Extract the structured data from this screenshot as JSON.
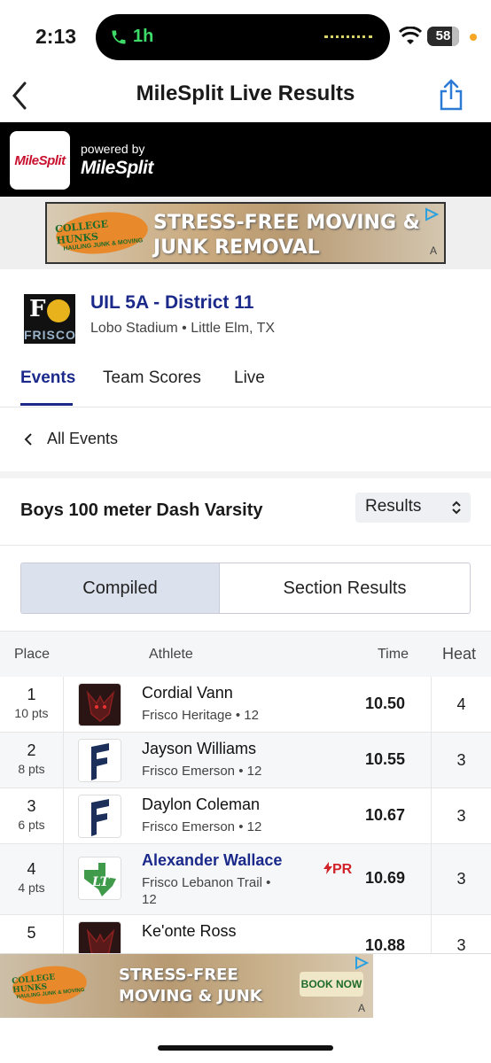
{
  "status_bar": {
    "time": "2:13",
    "call_duration": "1h",
    "battery": "58"
  },
  "nav": {
    "title": "MileSplit Live Results"
  },
  "brand_bar": {
    "logo_text": "MileSplit",
    "powered_by": "powered by",
    "brand_name": "MileSplit"
  },
  "ad_top": {
    "brand_line1": "COLLEGE HUNKS",
    "brand_line2": "HAULING JUNK & MOVING",
    "headline": "STRESS-FREE MOVING & JUNK REMOVAL",
    "badge": "A"
  },
  "meet": {
    "logo_text": "FRISCO",
    "title": "UIL 5A - District 11",
    "location": "Lobo Stadium • Little Elm, TX"
  },
  "tabs": [
    {
      "label": "Events",
      "active": true
    },
    {
      "label": "Team Scores",
      "active": false
    },
    {
      "label": "Live",
      "active": false
    }
  ],
  "all_events": "All Events",
  "event": {
    "title": "Boys 100 meter Dash Varsity",
    "view_select": "Results"
  },
  "segments": {
    "compiled": "Compiled",
    "sections": "Section Results"
  },
  "table": {
    "headers": {
      "place": "Place",
      "athlete": "Athlete",
      "time": "Time",
      "heat": "Heat"
    },
    "rows": [
      {
        "place": "1",
        "pts": "10 pts",
        "athlete": "Cordial Vann",
        "school": "Frisco Heritage • 12",
        "time": "10.50",
        "heat": "4",
        "pr": ""
      },
      {
        "place": "2",
        "pts": "8 pts",
        "athlete": "Jayson Williams",
        "school": "Frisco Emerson • 12",
        "time": "10.55",
        "heat": "3",
        "pr": ""
      },
      {
        "place": "3",
        "pts": "6 pts",
        "athlete": "Daylon Coleman",
        "school": "Frisco Emerson • 12",
        "time": "10.67",
        "heat": "3",
        "pr": ""
      },
      {
        "place": "4",
        "pts": "4 pts",
        "athlete": "Alexander Wallace",
        "school": "Frisco Lebanon Trail •",
        "school2": "12",
        "time": "10.69",
        "heat": "3",
        "pr": "PR"
      },
      {
        "place": "5",
        "pts": "",
        "athlete": "Ke'onte Ross",
        "school": "",
        "time": "10.88",
        "heat": "3",
        "pr": ""
      }
    ]
  },
  "ad_bottom": {
    "brand_line1": "COLLEGE HUNKS",
    "brand_line2": "HAULING JUNK & MOVING",
    "headline_line1": "STRESS-FREE",
    "headline_line2": "MOVING & JUNK",
    "cta": "BOOK NOW",
    "badge": "A"
  },
  "colors": {
    "brand_blue": "#1b2a8a",
    "pr_red": "#d0232a",
    "call_green": "#3ddc68"
  }
}
